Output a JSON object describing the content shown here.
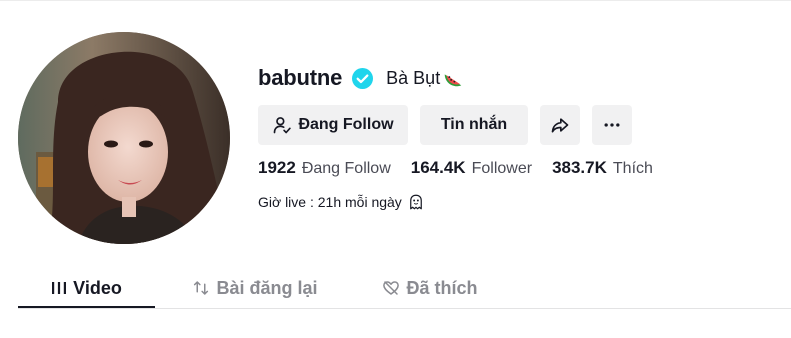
{
  "profile": {
    "username": "babutne",
    "verified_icon": "verified-badge-icon",
    "nickname": "Bà  Bụt",
    "nickname_emoji": "watermelon-icon",
    "bio": "Giờ live : 21h mỗi ngày",
    "bio_emoji": "ghost-icon"
  },
  "actions": {
    "following_label": "Đang Follow",
    "message_label": "Tin nhắn",
    "share_icon": "share-icon",
    "more_icon": "more-icon"
  },
  "stats": [
    {
      "value": "1922",
      "label": "Đang Follow"
    },
    {
      "value": "164.4K",
      "label": "Follower"
    },
    {
      "value": "383.7K",
      "label": "Thích"
    }
  ],
  "tabs": [
    {
      "label": "Video",
      "icon": "grid-icon",
      "active": true
    },
    {
      "label": "Bài đăng lại",
      "icon": "repost-icon",
      "active": false
    },
    {
      "label": "Đã thích",
      "icon": "liked-heart-icon",
      "active": false
    }
  ],
  "colors": {
    "verified": "#20d5ec",
    "button_bg": "#f1f1f2",
    "text_primary": "#161823",
    "text_secondary": "#8a8b91"
  }
}
